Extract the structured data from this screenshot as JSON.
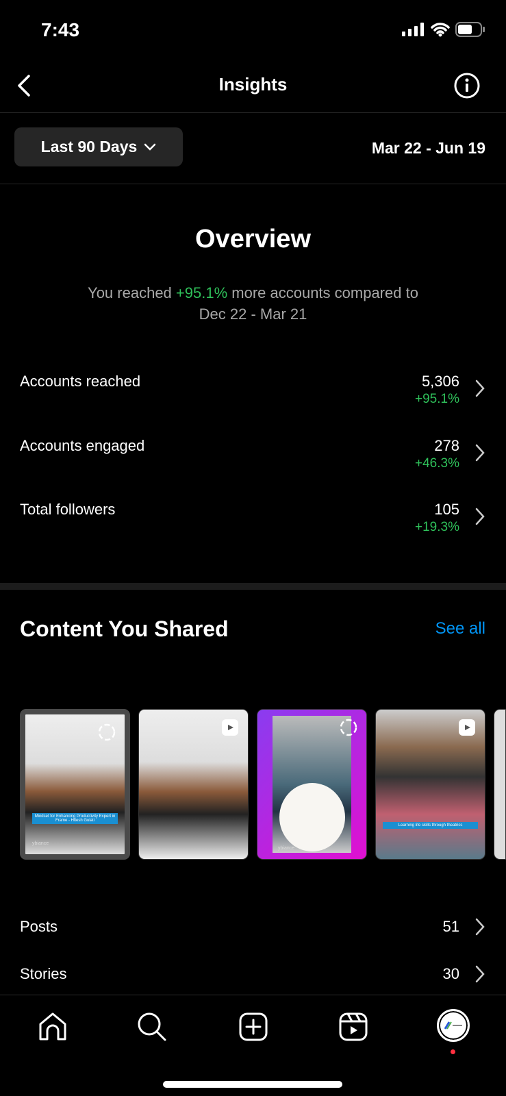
{
  "status_bar": {
    "time": "7:43"
  },
  "header": {
    "title": "Insights",
    "back_icon": "chevron-left-icon",
    "info_icon": "info-icon"
  },
  "filter": {
    "selected": "Last 90 Days",
    "date_range": "Mar 22 - Jun 19"
  },
  "overview": {
    "title": "Overview",
    "subtitle_pre": "You reached ",
    "subtitle_pct": "+95.1%",
    "subtitle_post": " more accounts compared to",
    "subtitle_line2": "Dec 22 - Mar 21",
    "metrics": [
      {
        "label": "Accounts reached",
        "value": "5,306",
        "change": "+95.1%"
      },
      {
        "label": "Accounts engaged",
        "value": "278",
        "change": "+46.3%"
      },
      {
        "label": "Total followers",
        "value": "105",
        "change": "+19.3%"
      }
    ]
  },
  "content": {
    "title": "Content You Shared",
    "see_all": "See all",
    "thumbnails": [
      {
        "type": "story",
        "caption": "Mindset for Enhancing Productivity Expert in Frame - Hitesh Gulati",
        "watermark": "ybiance"
      },
      {
        "type": "reel",
        "caption": "",
        "watermark": ""
      },
      {
        "type": "story",
        "caption": "",
        "watermark": "ybiance"
      },
      {
        "type": "reel",
        "caption": "Learning life skills through theatrics",
        "watermark": ""
      }
    ],
    "counts": [
      {
        "label": "Posts",
        "value": "51"
      },
      {
        "label": "Stories",
        "value": "30"
      }
    ]
  },
  "nav": {
    "items": [
      "home-icon",
      "search-icon",
      "create-icon",
      "reels-icon",
      "profile-avatar"
    ]
  },
  "colors": {
    "accent": "#0095f6",
    "positive": "#2fc05a",
    "notification": "#ff3040"
  }
}
